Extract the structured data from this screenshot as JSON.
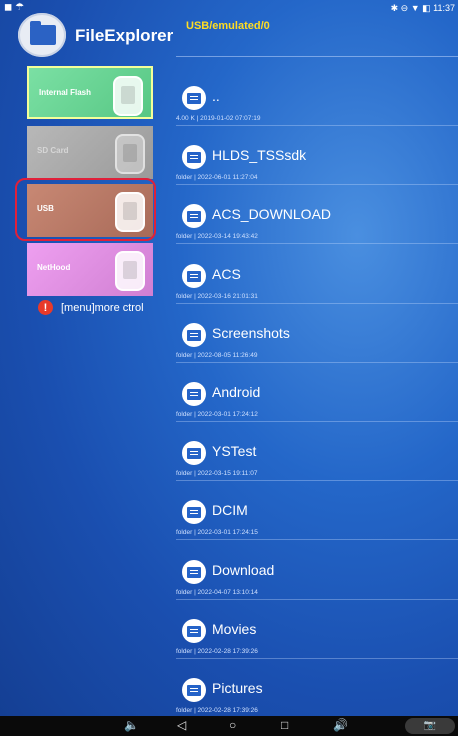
{
  "statusbar": {
    "left_icons": "◼ ☂",
    "right_icons": "✱ ⊖ ▼ ◧",
    "time": "11:37"
  },
  "header": {
    "app_title": "FileExplorer",
    "path": "USB/emulated/0",
    "app_icon": "folder-icon"
  },
  "sidebar": {
    "storages": [
      {
        "label": "Internal Flash",
        "icon": "chip-icon",
        "color": "#6fd898"
      },
      {
        "label": "SD Card",
        "icon": "sdcard-icon",
        "color": "#aaaaaa"
      },
      {
        "label": "USB",
        "icon": "usb-icon",
        "color": "#b87a66"
      },
      {
        "label": "NetHood",
        "icon": "network-icon",
        "color": "#e08fe2"
      }
    ],
    "more_label": "[menu]more ctrol"
  },
  "files": [
    {
      "name": "..",
      "info": "4.00 K | 2019-01-02 07:07:19"
    },
    {
      "name": "HLDS_TSSsdk",
      "info": "folder | 2022-06-01 11:27:04"
    },
    {
      "name": "ACS_DOWNLOAD",
      "info": "folder | 2022-03-14 19:43:42"
    },
    {
      "name": "ACS",
      "info": "folder | 2022-03-16 21:01:31"
    },
    {
      "name": "Screenshots",
      "info": "folder | 2022-08-05 11:26:49"
    },
    {
      "name": "Android",
      "info": "folder | 2022-03-01 17:24:12"
    },
    {
      "name": "YSTest",
      "info": "folder | 2022-03-15 19:11:07"
    },
    {
      "name": "DCIM",
      "info": "folder | 2022-03-01 17:24:15"
    },
    {
      "name": "Download",
      "info": "folder | 2022-04-07 13:10:14"
    },
    {
      "name": "Movies",
      "info": "folder | 2022-02-28 17:39:26"
    },
    {
      "name": "Pictures",
      "info": "folder | 2022-02-28 17:39:26"
    }
  ],
  "navbar": {
    "vol_down": "🔈",
    "back": "◁",
    "home": "○",
    "recents": "□",
    "vol_up": "🔊",
    "screenshot": "📷"
  }
}
